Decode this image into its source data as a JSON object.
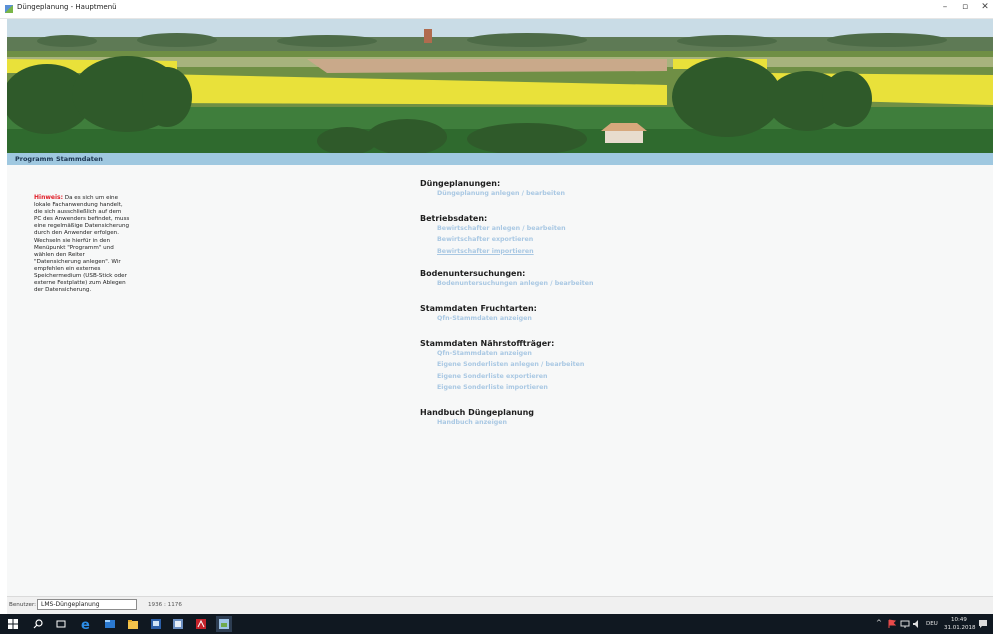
{
  "window": {
    "title": "Düngeplanung - Hauptmenü",
    "minimize": "–",
    "maximize": "▫",
    "close": "✕"
  },
  "menu": [
    "Programm",
    "Stammdaten"
  ],
  "hint": {
    "label": "Hinweis:",
    "text": " Da es sich um eine lokale Fachanwendung handelt, die sich ausschließlich auf dem PC des Anwenders befindet, muss eine regelmäßige Datensicherung durch den Anwender erfolgen. Wechseln sie hierfür in den Menüpunkt \"Programm\" und wählen den Reiter \"Datensicherung anlegen\". Wir empfehlen ein externes Speichermedium (USB-Stick oder externe Festplatte) zum Ablegen der Datensicherung."
  },
  "sections": [
    {
      "title": "Düngeplanungen:",
      "links": [
        "Düngeplanung anlegen / bearbeiten"
      ]
    },
    {
      "title": "Betriebsdaten:",
      "links": [
        "Bewirtschafter anlegen / bearbeiten",
        "Bewirtschafter exportieren",
        "Bewirtschafter importieren"
      ]
    },
    {
      "title": "Bodenuntersuchungen:",
      "links": [
        "Bodenuntersuchungen anlegen / bearbeiten"
      ]
    },
    {
      "title": "Stammdaten Fruchtarten:",
      "links": [
        "Qfn-Stammdaten anzeigen"
      ]
    },
    {
      "title": "Stammdaten Nährstoffträger:",
      "links": [
        "Qfn-Stammdaten anzeigen",
        "Eigene Sonderlisten anlegen / bearbeiten",
        "Eigene Sonderliste exportieren",
        "Eigene Sonderliste importieren"
      ]
    },
    {
      "title": "Handbuch Düngeplanung",
      "links": [
        "Handbuch anzeigen"
      ]
    }
  ],
  "status": {
    "label": "Benutzer:",
    "user": "LMS-Düngeplanung",
    "resolution": "1936 : 1176"
  },
  "taskbar": {
    "tray_chevron": "^",
    "lang": "DEU",
    "time": "10:49",
    "date": "31.01.2018"
  },
  "colors": {
    "menubar": "#9fc8e0",
    "link": "#a9c8e3",
    "hint_label": "#e0212b"
  }
}
